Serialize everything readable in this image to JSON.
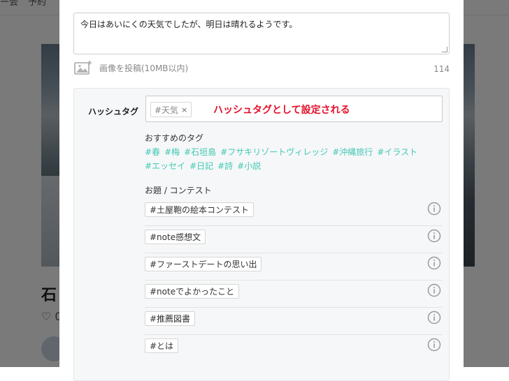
{
  "background": {
    "topbar_fragments": [
      "ー会",
      "予約"
    ],
    "title_fragment": "石",
    "like_fragment": "♡ 0"
  },
  "composer": {
    "body_text": "今日はあいにくの天気でしたが、明日は晴れるようです。",
    "image_upload_label": "画像を投稿(10MB以内)",
    "char_count": "114"
  },
  "hashtags": {
    "label": "ハッシュタグ",
    "chips": [
      {
        "text": "#天気",
        "remove": "×"
      }
    ],
    "annotation": "ハッシュタグとして設定される",
    "recommended_title": "おすすめのタグ",
    "recommended": [
      "#春",
      "#梅",
      "#石垣島",
      "#フサキリゾートヴィレッジ",
      "#沖縄旅行",
      "#イラスト",
      "#エッセイ",
      "#日記",
      "#詩",
      "#小説"
    ],
    "contest_title": "お題 / コンテスト",
    "contests": [
      "#土屋鞄の絵本コンテスト",
      "#note感想文",
      "#ファーストデートの思い出",
      "#noteでよかったこと",
      "#推薦図書",
      "#とは"
    ]
  },
  "colors": {
    "accent_teal": "#41c9b4",
    "annotation_red": "#e4102a"
  },
  "icons": {
    "image_upload": "image-add-icon",
    "remove_chip": "close-icon",
    "contest_info": "info-icon"
  }
}
